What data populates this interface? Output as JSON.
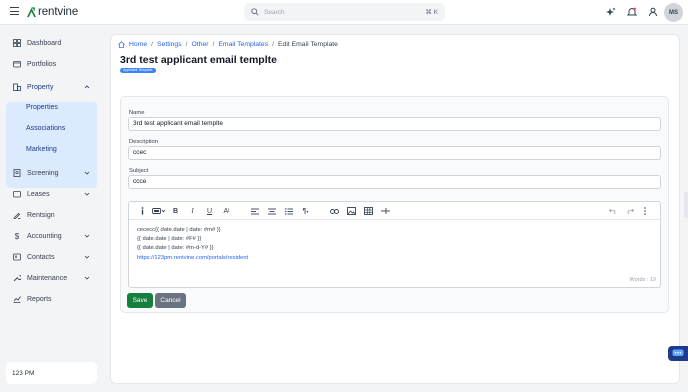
{
  "app": {
    "logo_text": "rentvine"
  },
  "search": {
    "placeholder": "Search",
    "shortcut": "⌘ K"
  },
  "user": {
    "initials": "MS"
  },
  "sidebar": {
    "items": [
      {
        "label": "Dashboard",
        "icon": "dashboard-icon"
      },
      {
        "label": "Portfolios",
        "icon": "portfolio-icon"
      },
      {
        "label": "Property",
        "icon": "property-icon",
        "expanded": true
      },
      {
        "label": "Screening",
        "icon": "screening-icon"
      },
      {
        "label": "Leases",
        "icon": "leases-icon"
      },
      {
        "label": "Rentsign",
        "icon": "rentsign-icon"
      },
      {
        "label": "Accounting",
        "icon": "dollar-icon"
      },
      {
        "label": "Contacts",
        "icon": "contacts-icon"
      },
      {
        "label": "Maintenance",
        "icon": "wrench-icon"
      },
      {
        "label": "Reports",
        "icon": "reports-icon"
      }
    ],
    "property_sub": [
      "Properties",
      "Associations",
      "Marketing"
    ],
    "clock": "123 PM"
  },
  "breadcrumb": [
    "Home",
    "Settings",
    "Other",
    "Email Templates",
    "Edit Email Template"
  ],
  "page": {
    "title": "3rd test applicant email templte",
    "badge": "Applicant Template"
  },
  "form": {
    "name_label": "Name",
    "name_value": "3rd test applicant email templte",
    "description_label": "Description",
    "description_value": "ccec",
    "subject_label": "Subject",
    "subject_value": "ccce"
  },
  "editor": {
    "lines": [
      "cececc{{ date.date | date: #m# }}",
      "{{ date.date | date: #F# }}",
      "{{ date.date | date: #m-d-Y# }}"
    ],
    "link": "https://123pm.rentvine.com/portals/resident",
    "word_count": "Words : 19"
  },
  "actions": {
    "save": "Save",
    "cancel": "Cancel"
  },
  "colors": {
    "accent": "#2563eb",
    "save": "#15803d",
    "cancel": "#6b7280",
    "active_group": "#dbeafe"
  }
}
